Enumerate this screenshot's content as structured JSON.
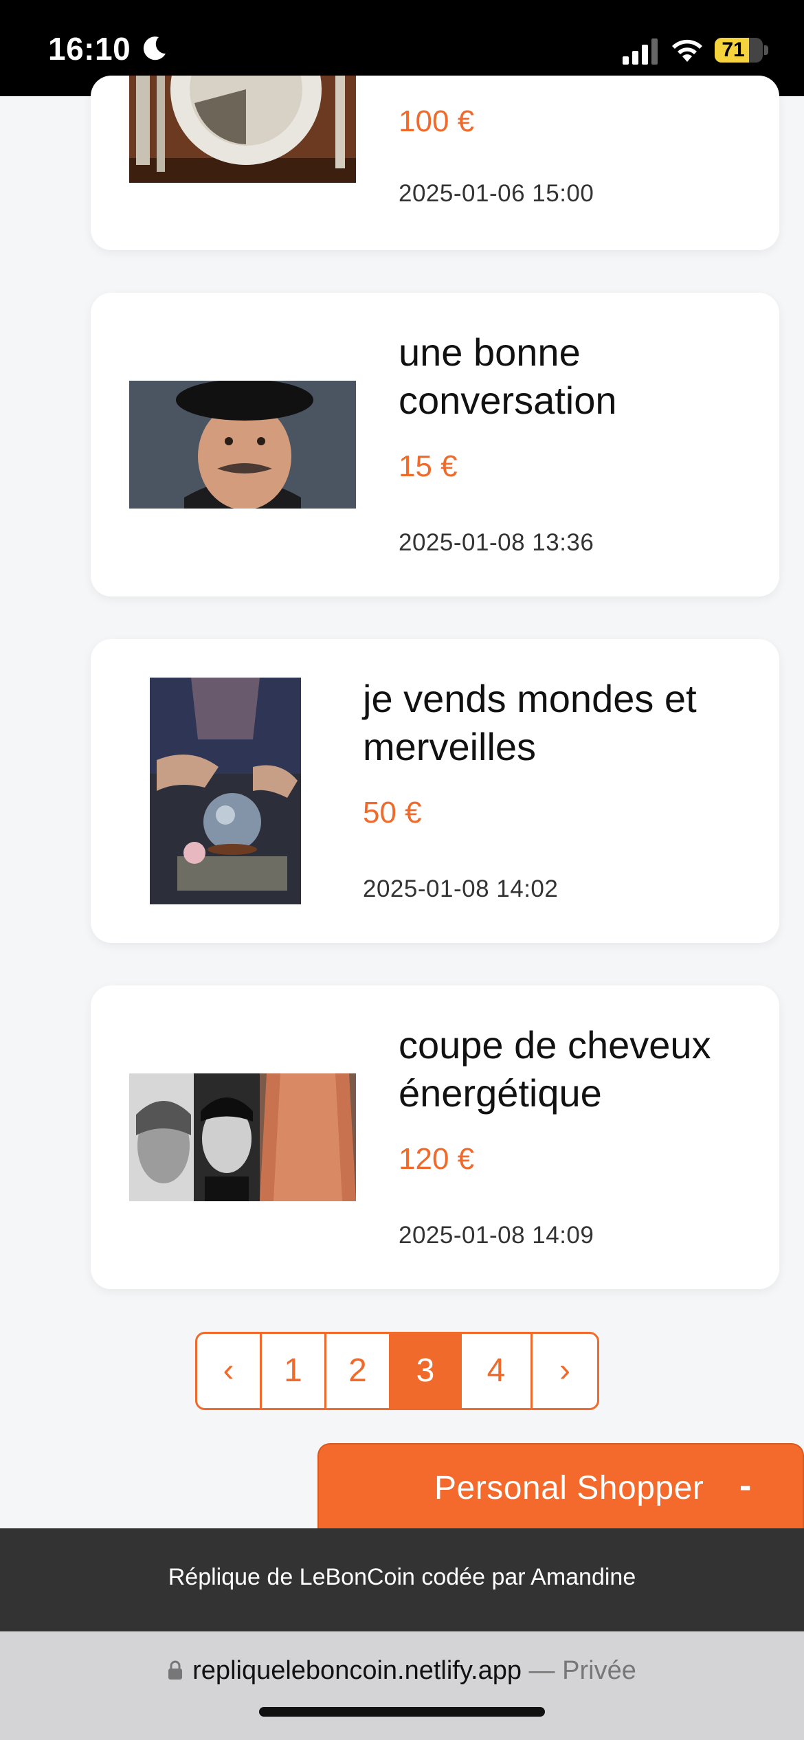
{
  "status_bar": {
    "time": "16:10",
    "battery": "71",
    "battery_level": 0.71
  },
  "listings": [
    {
      "title": "",
      "price": "100 €",
      "date": "2025-01-06 15:00",
      "image": "plate-with-cutlery-photo"
    },
    {
      "title": "une bonne conversation",
      "price": "15 €",
      "date": "2025-01-08 13:36",
      "image": "man-in-beret-photo"
    },
    {
      "title": "je vends mondes et merveilles",
      "price": "50 €",
      "date": "2025-01-08 14:02",
      "image": "crystal-ball-photo"
    },
    {
      "title": "coupe de cheveux énergétique",
      "price": "120 €",
      "date": "2025-01-08 14:09",
      "image": "haircut-collage-photo"
    }
  ],
  "pagination": {
    "prev": "‹",
    "pages": [
      "1",
      "2",
      "3",
      "4"
    ],
    "next": "›",
    "current": "3"
  },
  "personal_shopper": {
    "label": "Personal Shopper",
    "toggle": "-"
  },
  "footer": {
    "text": "Réplique de LeBonCoin codée par Amandine"
  },
  "browser": {
    "url": "repliqueleboncoin.netlify.app",
    "separator": " — ",
    "mode": "Privée"
  },
  "colors": {
    "accent": "#f06a2b",
    "footer_bg": "#333333",
    "page_bg": "#f5f6f8"
  }
}
